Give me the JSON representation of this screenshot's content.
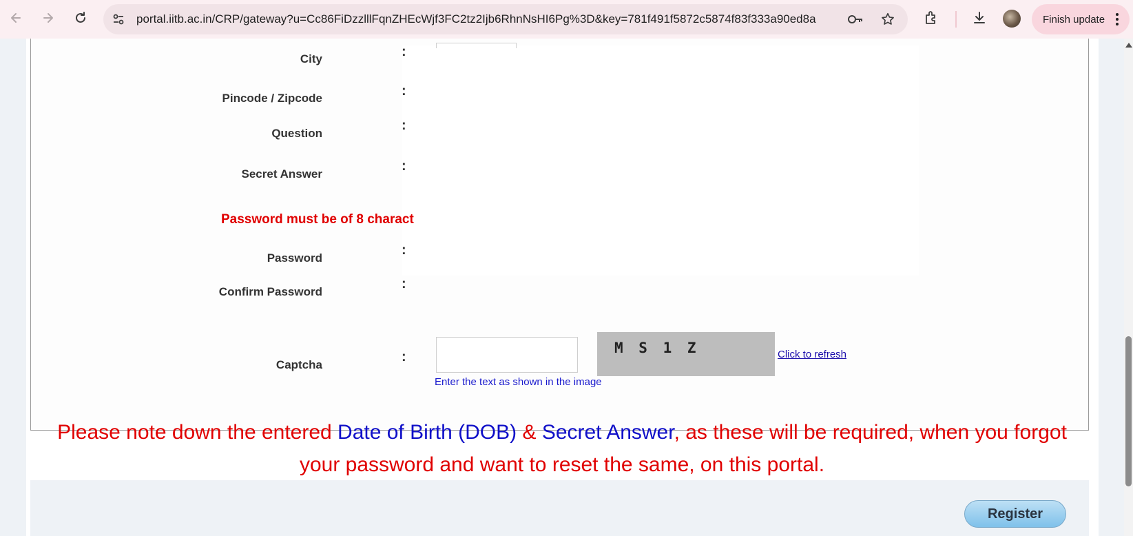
{
  "browser": {
    "url": "portal.iitb.ac.in/CRP/gateway?u=Cc86FiDzzlllFqnZHEcWjf3FC2tz2Ijb6RhnNsHI6Pg%3D&key=781f491f5872c5874f83f333a90ed8a",
    "finish_update_label": "Finish update"
  },
  "form": {
    "labels": {
      "city": "City",
      "pincode": "Pincode / Zipcode",
      "question": "Question",
      "secret_answer": "Secret Answer",
      "password": "Password",
      "confirm_password": "Confirm Password",
      "captcha": "Captcha"
    },
    "colon": ":",
    "password_note": "Password must be of 8 charact",
    "captcha": {
      "input_value": "",
      "image_text": "M S 1 Z",
      "refresh_label": "Click to refresh",
      "hint": "Enter the text as shown in the image"
    }
  },
  "notice": {
    "part1": "Please note down the entered ",
    "dob": "Date of Birth (DOB)",
    "amp": " & ",
    "secret": "Secret Answer",
    "part2": ", as these will be required, when you forgot your password and want to reset the same, on this portal."
  },
  "actions": {
    "register_label": "Register"
  },
  "colors": {
    "error_red": "#e00000",
    "highlight_blue": "#1010c8",
    "chrome_pink": "#fbeff2"
  }
}
